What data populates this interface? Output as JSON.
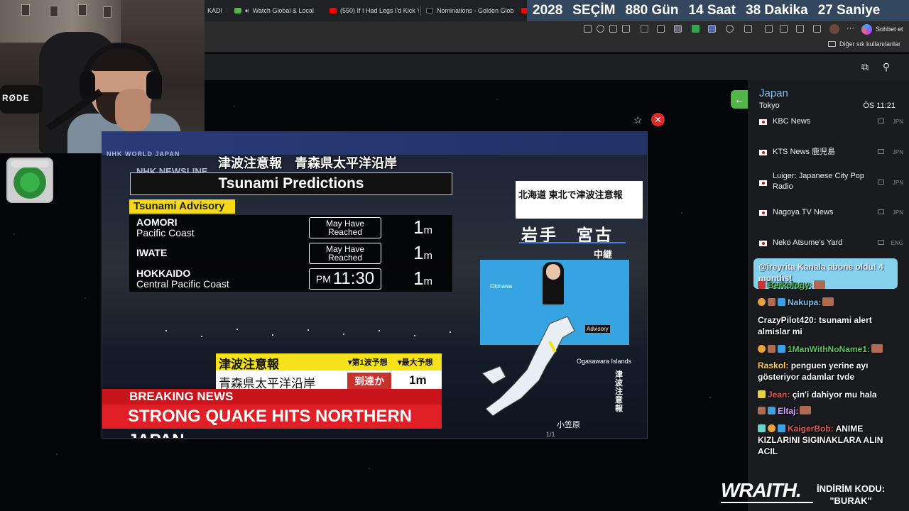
{
  "browser": {
    "tabs": [
      {
        "label": "KADI",
        "favicon_color": "#cc2a2a"
      },
      {
        "label": "Watch Global & Local",
        "favicon_color": "#54b548"
      },
      {
        "label": "(550) If I Had Legs I'd Kick Y",
        "favicon_color": "#ff0000"
      },
      {
        "label": "Nominations - Golden Glob",
        "favicon_color": "#111111"
      }
    ],
    "countdown": [
      "2028",
      "SEÇİM",
      "880 Gün",
      "14 Saat",
      "38 Dakika",
      "27 Saniye"
    ],
    "copilot_label": "Sohbet et",
    "bookmarks_other": "Diğer sık kullanılanlar"
  },
  "webcam": {
    "mic_brand": "RØDE"
  },
  "video": {
    "nhk_world": "NHK WORLD JAPAN",
    "jp_title": "津波注意報　青森県太平洋沿岸",
    "newsline": "NHK NEWSLINE",
    "title": "Tsunami Predictions",
    "advisory": "Tsunami Advisory",
    "rows": [
      {
        "region": "AOMORI",
        "area": "Pacific Coast",
        "status": "May Have Reached",
        "height": "1",
        "unit": "m"
      },
      {
        "region": "IWATE",
        "area": "",
        "status": "May Have Reached",
        "height": "1",
        "unit": "m"
      },
      {
        "region": "HOKKAIDO",
        "area": "Central Pacific Coast",
        "time_prefix": "PM",
        "time": "11:30",
        "height": "1",
        "unit": "m"
      }
    ],
    "jp_box": {
      "header": "津波注意報",
      "first_wave": "▾第1波予想",
      "max_pred": "▾最大予想",
      "region": "青森県太平洋沿岸",
      "arrival": "到達か",
      "height": "1m"
    },
    "breaking": "BREAKING NEWS",
    "headline": "STRONG QUAKE HITS NORTHERN JAPAN",
    "hokkaido_jp": "北海道 東北で津波注意報",
    "iwate_jp": "岩手　宮古",
    "relay_jp": "中継",
    "okinawa": "Okinawa",
    "advisory_map": "Advisory",
    "ogasawara": "Ogasawara Islands",
    "vertical_jp": "津波注意報",
    "ogasawara_jp": "小笠原",
    "counter": "1/1"
  },
  "panel": {
    "title": "Japan",
    "city": "Tokyo",
    "time": "ÖS 11:21",
    "channels": [
      {
        "name": "KBC News",
        "lang": "JPN"
      },
      {
        "name": "KTS News 鹿児島",
        "lang": "JPN"
      },
      {
        "name": "Luiger: Japanese City Pop Radio",
        "lang": "JPN"
      },
      {
        "name": "Nagoya TV News",
        "lang": "JPN"
      },
      {
        "name": "Neko Atsume's Yard",
        "lang": "ENG"
      }
    ]
  },
  "chat": {
    "sub_alert": "@ireyrita Kanala abone oldu! 4 months!",
    "messages": [
      {
        "user": "Berkology:",
        "text": "",
        "color": "#5cc85c"
      },
      {
        "user": "Nakupa:",
        "text": "",
        "color": "#7ec3ef"
      },
      {
        "user": "CrazyPilot420:",
        "text": "tsunami alert almislar mi",
        "color": "#ffffff"
      },
      {
        "user": "1ManWithNoName1:",
        "text": "",
        "color": "#5cc85c"
      },
      {
        "user": "Raskol:",
        "text": "penguen yerine ayı gösteriyor adamlar tvde",
        "color": "#ffd24a"
      },
      {
        "user": "Jean:",
        "text": "çin'i dahiyor mu hala",
        "color": "#e05c5c"
      },
      {
        "user": "Eltaj:",
        "text": "",
        "color": "#d3a8ff"
      },
      {
        "user": "KaigerBob:",
        "text": "ANIME KIZLARINI SIGINAKLARA ALIN ACIL",
        "color": "#e05c5c"
      }
    ]
  },
  "banner": {
    "brand": "WRAITH.",
    "promo_line1": "İNDİRİM KODU:",
    "promo_line2": "\"BURAK\""
  }
}
